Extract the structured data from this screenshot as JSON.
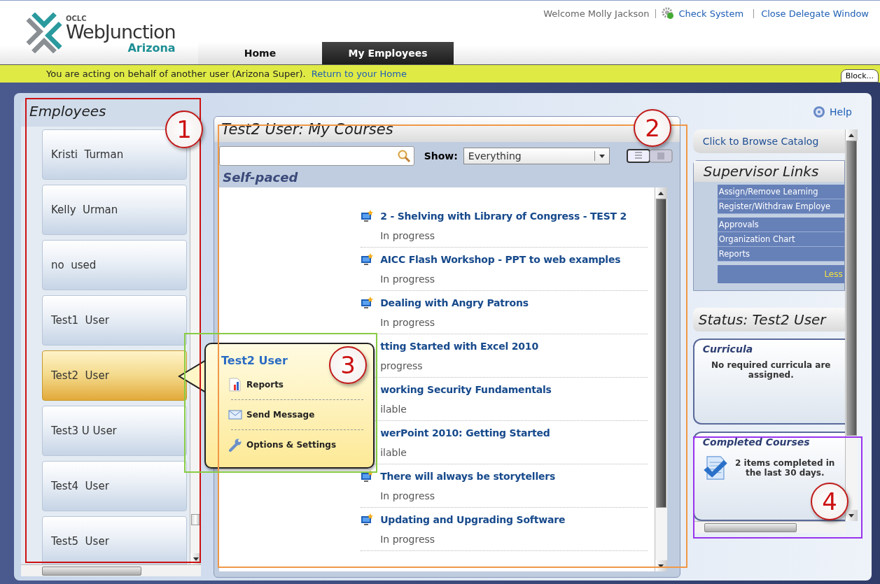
{
  "header": {
    "logo": {
      "small": "OCLC",
      "name": "WebJunction",
      "region": "Arizona"
    },
    "tabs": [
      {
        "label": "Home",
        "selected": false
      },
      {
        "label": "My Employees",
        "selected": true
      }
    ],
    "welcome": "Welcome Molly Jackson",
    "links": [
      "Check System",
      "Close Delegate Window"
    ]
  },
  "delegate_bar": {
    "message": "You are acting on behalf of another user (Arizona Super).",
    "link": "Return to your Home",
    "button": "Block..."
  },
  "employees": {
    "title": "Employees",
    "items": [
      {
        "name": "Kristi  Turman",
        "selected": false
      },
      {
        "name": "Kelly  Urman",
        "selected": false
      },
      {
        "name": "no  used",
        "selected": false
      },
      {
        "name": "Test1  User",
        "selected": false
      },
      {
        "name": "Test2  User",
        "selected": true
      },
      {
        "name": "Test3 U User",
        "selected": false
      },
      {
        "name": "Test4  User",
        "selected": false
      },
      {
        "name": "Test5  User",
        "selected": false
      }
    ]
  },
  "courses": {
    "title": "Test2  User: My Courses",
    "show_label": "Show:",
    "show_value": "Everything",
    "section": "Self-paced",
    "items": [
      {
        "title": "2 - Shelving with Library of Congress - TEST 2",
        "status": "In progress",
        "icon": true
      },
      {
        "title": "AICC Flash Workshop - PPT to web examples",
        "status": "In progress",
        "icon": true
      },
      {
        "title": "Dealing with Angry Patrons",
        "status": "In progress",
        "icon": true
      },
      {
        "title": "tting Started with Excel 2010",
        "status": "progress"
      },
      {
        "title": "working Security Fundamentals",
        "status": "ilable"
      },
      {
        "title": "werPoint 2010: Getting Started",
        "status": "ilable"
      },
      {
        "title": "There will always be storytellers",
        "status": "In progress",
        "icon": true
      },
      {
        "title": "Updating and Upgrading Software",
        "status": "In progress",
        "icon": true
      }
    ]
  },
  "popup": {
    "title": "Test2 User",
    "items": [
      {
        "label": "Reports",
        "kind": "reports"
      },
      {
        "label": "Send Message",
        "kind": "message"
      },
      {
        "label": "Options & Settings",
        "kind": "settings"
      }
    ]
  },
  "right": {
    "help": "Help",
    "browse": "Click to Browse Catalog",
    "supervisor": {
      "title": "Supervisor Links",
      "groups": [
        [
          "Assign/Remove Learning",
          "Register/Withdraw Employe"
        ],
        [
          "Approvals",
          "Organization Chart",
          "Reports"
        ]
      ],
      "more": "Less"
    },
    "status_title": "Status: Test2 User",
    "cards": [
      {
        "title": "Curricula",
        "text": "No required curricula are assigned.",
        "kind": "plain"
      },
      {
        "title": "Completed Courses",
        "text": "2 items completed in the last 30 days.",
        "kind": "completed"
      }
    ]
  },
  "annotations": [
    {
      "label": "1",
      "color": "#cc1111"
    },
    {
      "label": "2",
      "color": "#f09848"
    },
    {
      "label": "3",
      "color": "#88cc44"
    },
    {
      "label": "4",
      "color": "#9933ee"
    }
  ]
}
